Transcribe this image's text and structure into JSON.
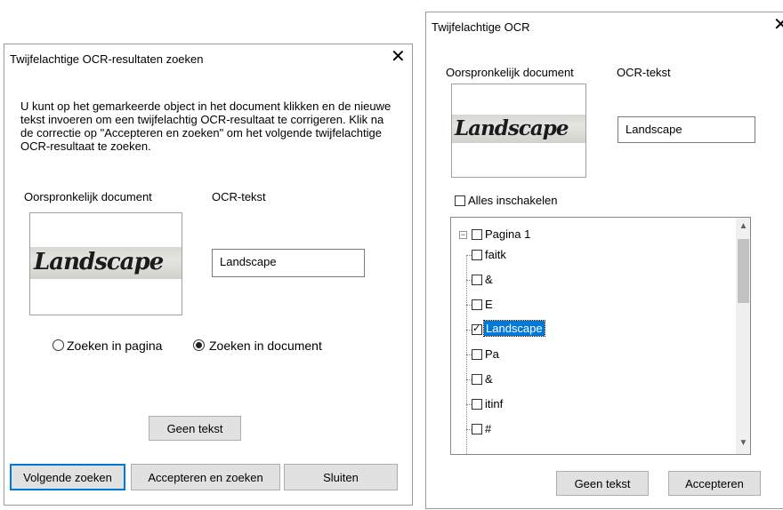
{
  "left_dialog": {
    "title": "Twijfelachtige OCR-resultaten zoeken",
    "close_glyph": "✕",
    "description": "U kunt op het gemarkeerde object in het document klikken en de nieuwe tekst invoeren om een twijfelachtig OCR-resultaat te corrigeren. Klik na de correctie op \"Accepteren en zoeken\" om het volgende twijfelachtige OCR-resultaat te zoeken.",
    "original_label": "Oorspronkelijk document",
    "ocr_label": "OCR-tekst",
    "image_word": "Landscape",
    "ocr_value": "Landscape",
    "radio_page": "Zoeken in pagina",
    "radio_document": "Zoeken in document",
    "radio_selected": "document",
    "no_text_button": "Geen tekst",
    "find_next_button": "Volgende zoeken",
    "accept_find_button": "Accepteren en zoeken",
    "close_button": "Sluiten"
  },
  "right_dialog": {
    "title": "Twijfelachtige OCR",
    "close_glyph": "✕",
    "original_label": "Oorspronkelijk document",
    "ocr_label": "OCR-tekst",
    "image_word": "Landscape",
    "ocr_value": "Landscape",
    "enable_all_label": "Alles inschakelen",
    "tree": {
      "root": "Pagina 1",
      "items": [
        {
          "label": "faitk",
          "checked": false,
          "selected": false
        },
        {
          "label": "&",
          "checked": false,
          "selected": false
        },
        {
          "label": "E",
          "checked": false,
          "selected": false
        },
        {
          "label": "Landscape",
          "checked": true,
          "selected": true
        },
        {
          "label": "Pa",
          "checked": false,
          "selected": false
        },
        {
          "label": "&",
          "checked": false,
          "selected": false
        },
        {
          "label": "itinf",
          "checked": false,
          "selected": false
        },
        {
          "label": "#",
          "checked": false,
          "selected": false
        }
      ]
    },
    "no_text_button": "Geen tekst",
    "accept_button": "Accepteren"
  },
  "icons": {
    "checkmark": "✓",
    "collapse": "−",
    "scroll_up": "▲",
    "scroll_down": "▼"
  }
}
